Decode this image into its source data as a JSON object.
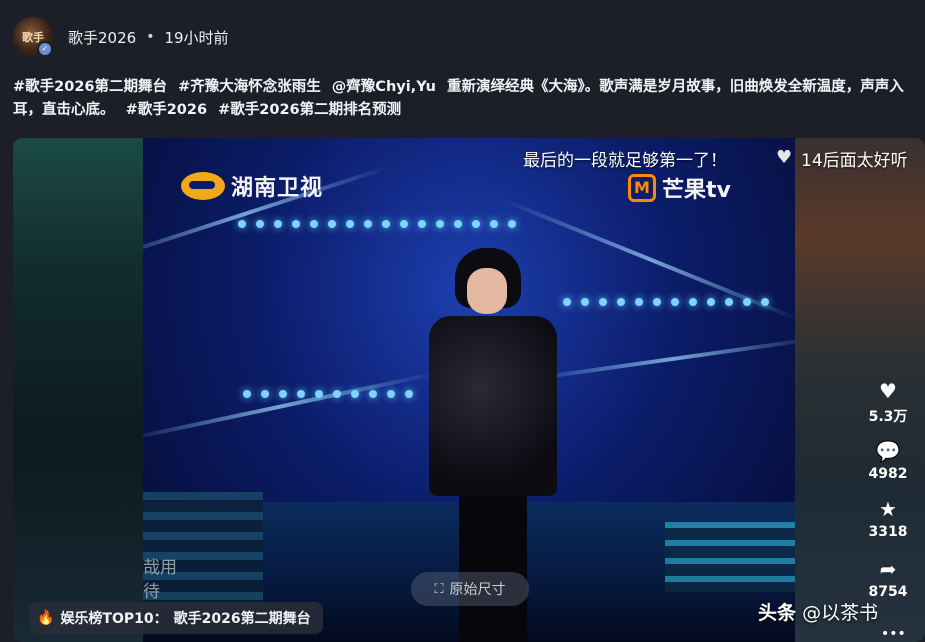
{
  "post": {
    "avatar_text": "歌手",
    "verified_badge": "✓",
    "author": "歌手2026",
    "separator": "•",
    "time": "19小时前"
  },
  "caption": {
    "tags_and_text": [
      "#歌手2026第二期舞台",
      "#齐豫大海怀念张雨生",
      "@齊豫Chyi,Yu",
      "重新演绎经典《大海》。歌声满是岁月故事，旧曲焕发全新温度，声声入耳，直击心底。",
      "#歌手2026",
      "#歌手2026第二期排名预测"
    ]
  },
  "video": {
    "danmaku": [
      "最后的一段就足够第一了！",
      "14后面太好听"
    ],
    "logo_hunan": "湖南卫视",
    "logo_mango": "芒果tv",
    "logo_mango_mark": "M",
    "subtitle_left": [
      "哉用",
      "待"
    ],
    "original_size_button": "原始尺寸",
    "original_size_icon": "expand-icon"
  },
  "rank_badge": {
    "label": "娱乐榜TOP10：",
    "title": "歌手2026第二期舞台"
  },
  "actions": {
    "like_count": "5.3万",
    "comment_count": "4982",
    "favorite_count": "3318",
    "share_count": "8754"
  },
  "watermark": {
    "brand": "头条",
    "handle": "@以茶书"
  },
  "colors": {
    "background": "#1c1f27",
    "mango_orange": "#ff8a00",
    "hunan_gold": "#f1a91a",
    "fire": "#ff5a3c"
  }
}
